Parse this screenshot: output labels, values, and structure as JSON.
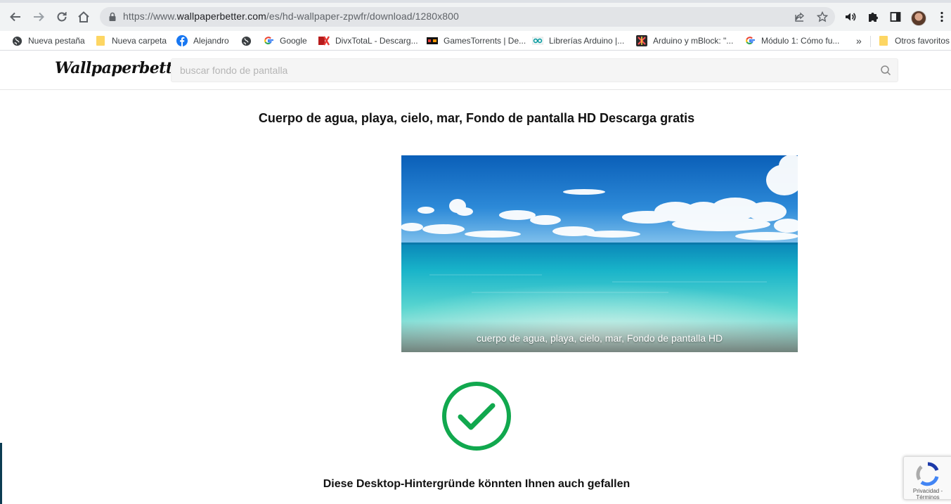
{
  "browser": {
    "url_prefix": "https://www.",
    "url_host": "wallpaperbetter.com",
    "url_path": "/es/hd-wallpaper-zpwfr/download/1280x800",
    "toolbar_icons": [
      "back-icon",
      "forward-icon",
      "reload-icon",
      "home-icon",
      "lock-icon",
      "share-icon",
      "star-icon",
      "speaker-icon",
      "puzzle-icon",
      "sidepanel-icon",
      "profile-avatar",
      "kebab-menu-icon"
    ]
  },
  "bookmarks": {
    "items": [
      {
        "label": "Nueva pestaña",
        "icon": "globe-icon"
      },
      {
        "label": "Nueva carpeta",
        "icon": "folder-icon"
      },
      {
        "label": "Alejandro",
        "icon": "facebook-icon"
      },
      {
        "label": "",
        "icon": "globe-icon"
      },
      {
        "label": "Google",
        "icon": "google-icon"
      },
      {
        "label": "DivxTotaL - Descarg...",
        "icon": "divxtotal-icon"
      },
      {
        "label": "GamesTorrents | De...",
        "icon": "gamestorrents-icon"
      },
      {
        "label": "Librerías Arduino |...",
        "icon": "arduino-icon"
      },
      {
        "label": "Arduino y mBlock: \"...",
        "icon": "mblock-icon"
      },
      {
        "label": "Módulo 1: Cómo fu...",
        "icon": "google-icon"
      }
    ],
    "overflow": "»",
    "other_label": "Otros favoritos"
  },
  "site": {
    "logo": "Wallpaperbetter",
    "search_placeholder": "buscar fondo de pantalla"
  },
  "main": {
    "title": "Cuerpo de agua, playa, cielo, mar, Fondo de pantalla HD Descarga gratis",
    "image_caption": "cuerpo de agua, playa, cielo, mar, Fondo de pantalla HD",
    "suggest_heading": "Diese Desktop-Hintergründe könnten Ihnen auch gefallen"
  },
  "recaptcha": {
    "privacy": "Privacidad",
    "separator": " - ",
    "terms": "Términos"
  },
  "colors": {
    "check_green": "#11a84e",
    "toolbar_bg": "#f1f3f4",
    "omnibox_bg": "#e2e4e7"
  }
}
